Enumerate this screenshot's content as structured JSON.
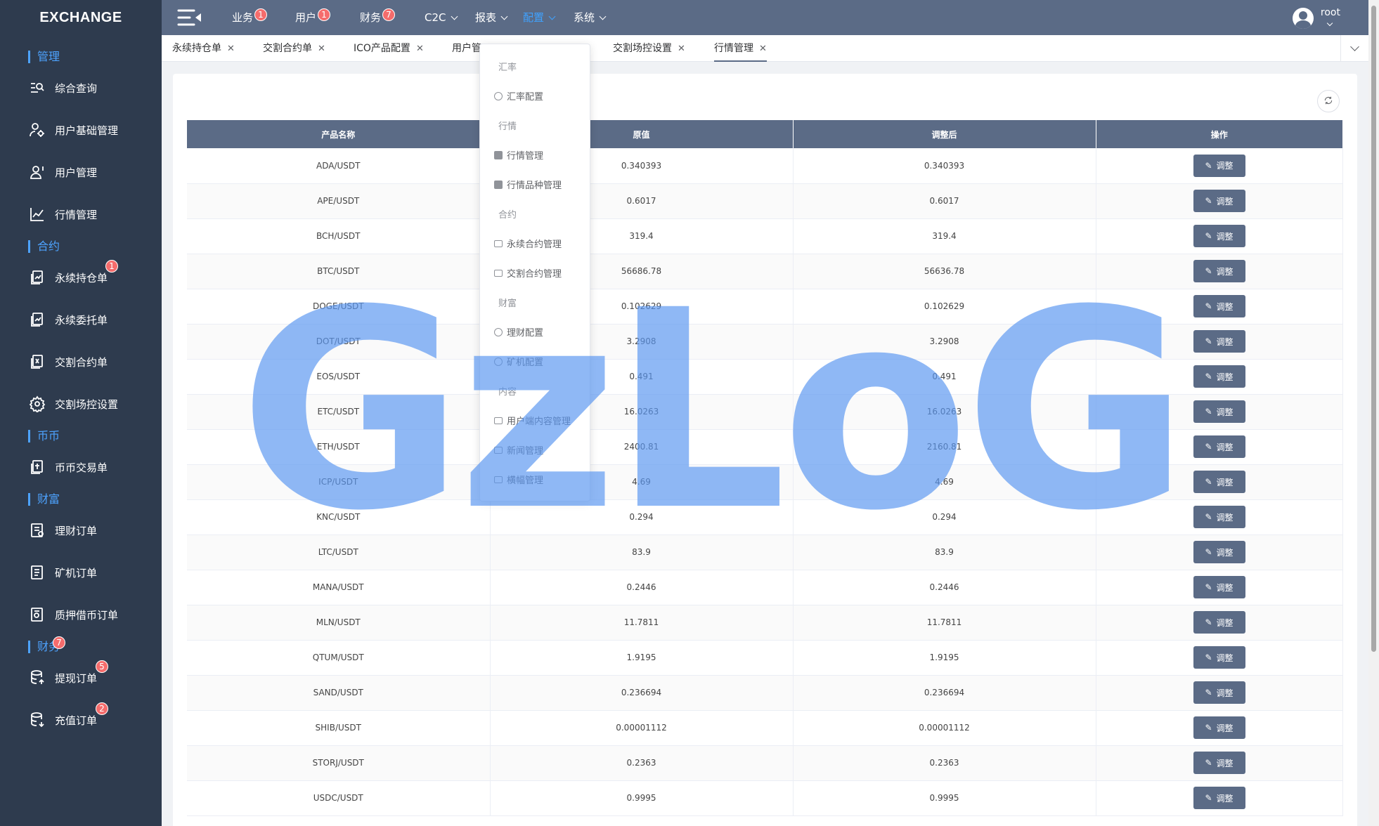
{
  "brand": "EXCHANGE",
  "sidebar": {
    "groups": [
      {
        "label": "管理"
      },
      {
        "label": "合约"
      },
      {
        "label": "币币"
      },
      {
        "label": "财富"
      },
      {
        "label": "财务",
        "badge": "7"
      }
    ],
    "items": [
      {
        "label": "综合查询",
        "icon": "search-list-icon"
      },
      {
        "label": "用户基础管理",
        "icon": "user-settings-icon"
      },
      {
        "label": "用户管理",
        "icon": "user-icon"
      },
      {
        "label": "行情管理",
        "icon": "line-chart-icon"
      },
      {
        "label": "永续持仓单",
        "icon": "contract-doc-icon",
        "badge": "1"
      },
      {
        "label": "永续委托单",
        "icon": "contract-doc-icon"
      },
      {
        "label": "交割合约单",
        "icon": "contract-doc-icon"
      },
      {
        "label": "交割场控设置",
        "icon": "gear-icon"
      },
      {
        "label": "币币交易单",
        "icon": "contract-doc-icon"
      },
      {
        "label": "理财订单",
        "icon": "finance-doc-icon"
      },
      {
        "label": "矿机订单",
        "icon": "list-doc-icon"
      },
      {
        "label": "质押借币订单",
        "icon": "pledge-doc-icon"
      },
      {
        "label": "提现订单",
        "icon": "database-out-icon",
        "badge": "5"
      },
      {
        "label": "充值订单",
        "icon": "database-in-icon",
        "badge": "2"
      }
    ]
  },
  "topnav": {
    "items": [
      {
        "label": "业务",
        "badge": "1"
      },
      {
        "label": "用户",
        "badge": "1"
      },
      {
        "label": "财务",
        "badge": "7"
      },
      {
        "label": "C2C"
      },
      {
        "label": "报表"
      },
      {
        "label": "配置"
      },
      {
        "label": "系统"
      }
    ],
    "user": "root"
  },
  "tabs": [
    {
      "label": "永续持仓单"
    },
    {
      "label": "交割合约单"
    },
    {
      "label": "ICO产品配置"
    },
    {
      "label": "用户管"
    },
    {
      "label": "交割场控设置"
    },
    {
      "label": "行情管理"
    }
  ],
  "dropdown": {
    "groups": [
      "汇率",
      "行情",
      "合约",
      "财富",
      "内容"
    ],
    "items": [
      {
        "label": "汇率配置",
        "icon": "gear-icon"
      },
      {
        "label": "行情管理",
        "icon": "check-icon"
      },
      {
        "label": "行情品种管理",
        "icon": "check-icon"
      },
      {
        "label": "永续合约管理",
        "icon": "box-icon"
      },
      {
        "label": "交割合约管理",
        "icon": "box-icon"
      },
      {
        "label": "理财配置",
        "icon": "gear-icon"
      },
      {
        "label": "矿机配置",
        "icon": "gear-icon"
      },
      {
        "label": "用户端内容管理",
        "icon": "box-icon"
      },
      {
        "label": "新闻管理",
        "icon": "box-icon"
      },
      {
        "label": "横幅管理",
        "icon": "box-icon"
      }
    ]
  },
  "table": {
    "headers": [
      "产品名称",
      "原值",
      "调整后",
      "操作"
    ],
    "button_label": "调整",
    "rows": [
      {
        "name": "ADA/USDT",
        "orig": "0.340393",
        "adj": "0.340393"
      },
      {
        "name": "APE/USDT",
        "orig": "0.6017",
        "adj": "0.6017"
      },
      {
        "name": "BCH/USDT",
        "orig": "319.4",
        "adj": "319.4"
      },
      {
        "name": "BTC/USDT",
        "orig": "56686.78",
        "adj": "56636.78"
      },
      {
        "name": "DOGE/USDT",
        "orig": "0.102629",
        "adj": "0.102629"
      },
      {
        "name": "DOT/USDT",
        "orig": "3.2908",
        "adj": "3.2908"
      },
      {
        "name": "EOS/USDT",
        "orig": "0.491",
        "adj": "0.491"
      },
      {
        "name": "ETC/USDT",
        "orig": "16.0263",
        "adj": "16.0263"
      },
      {
        "name": "ETH/USDT",
        "orig": "2400.81",
        "adj": "2160.81"
      },
      {
        "name": "ICP/USDT",
        "orig": "4.69",
        "adj": "4.69"
      },
      {
        "name": "KNC/USDT",
        "orig": "0.294",
        "adj": "0.294"
      },
      {
        "name": "LTC/USDT",
        "orig": "83.9",
        "adj": "83.9"
      },
      {
        "name": "MANA/USDT",
        "orig": "0.2446",
        "adj": "0.2446"
      },
      {
        "name": "MLN/USDT",
        "orig": "11.7811",
        "adj": "11.7811"
      },
      {
        "name": "QTUM/USDT",
        "orig": "1.9195",
        "adj": "1.9195"
      },
      {
        "name": "SAND/USDT",
        "orig": "0.236694",
        "adj": "0.236694"
      },
      {
        "name": "SHIB/USDT",
        "orig": "0.00001112",
        "adj": "0.00001112"
      },
      {
        "name": "STORJ/USDT",
        "orig": "0.2363",
        "adj": "0.2363"
      },
      {
        "name": "USDC/USDT",
        "orig": "0.9995",
        "adj": "0.9995"
      }
    ]
  },
  "watermark": "GzLoG",
  "colors": {
    "sidebar_bg": "#2e3b4e",
    "topbar_bg": "#5b6b86",
    "accent": "#4da3ff",
    "badge": "#f56c6c"
  }
}
